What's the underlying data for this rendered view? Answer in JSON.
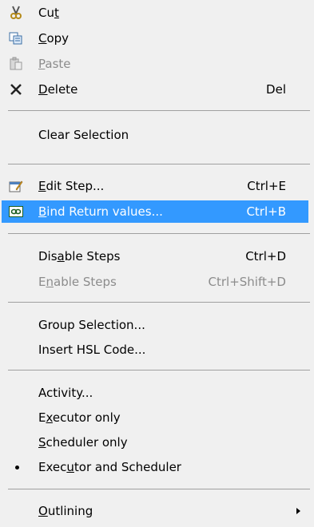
{
  "menu": {
    "cut": {
      "pre": "Cu",
      "u": "t",
      "post": ""
    },
    "copy": {
      "pre": "",
      "u": "C",
      "post": "opy"
    },
    "paste": {
      "pre": "",
      "u": "P",
      "post": "aste"
    },
    "delete": {
      "pre": "",
      "u": "D",
      "post": "elete",
      "shortcut": "Del"
    },
    "clear_selection": {
      "label": "Clear Selection"
    },
    "edit_step": {
      "pre": "",
      "u": "E",
      "post": "dit Step...",
      "shortcut": "Ctrl+E"
    },
    "bind_return": {
      "pre": "",
      "u": "B",
      "post": "ind Return values...",
      "shortcut": "Ctrl+B"
    },
    "disable_steps": {
      "pre": "Dis",
      "u": "a",
      "post": "ble Steps",
      "shortcut": "Ctrl+D"
    },
    "enable_steps": {
      "pre": "E",
      "u": "n",
      "post": "able Steps",
      "shortcut": "Ctrl+Shift+D"
    },
    "group_selection": {
      "label": "Group Selection..."
    },
    "insert_hsl": {
      "label": "Insert HSL Code..."
    },
    "activity": {
      "label": "Activity..."
    },
    "executor_only": {
      "pre": "E",
      "u": "x",
      "post": "ecutor only"
    },
    "scheduler_only": {
      "pre": "",
      "u": "S",
      "post": "cheduler only"
    },
    "executor_scheduler": {
      "pre": "Exec",
      "u": "u",
      "post": "tor and Scheduler"
    },
    "outlining": {
      "pre": "",
      "u": "O",
      "post": "utlining"
    }
  }
}
